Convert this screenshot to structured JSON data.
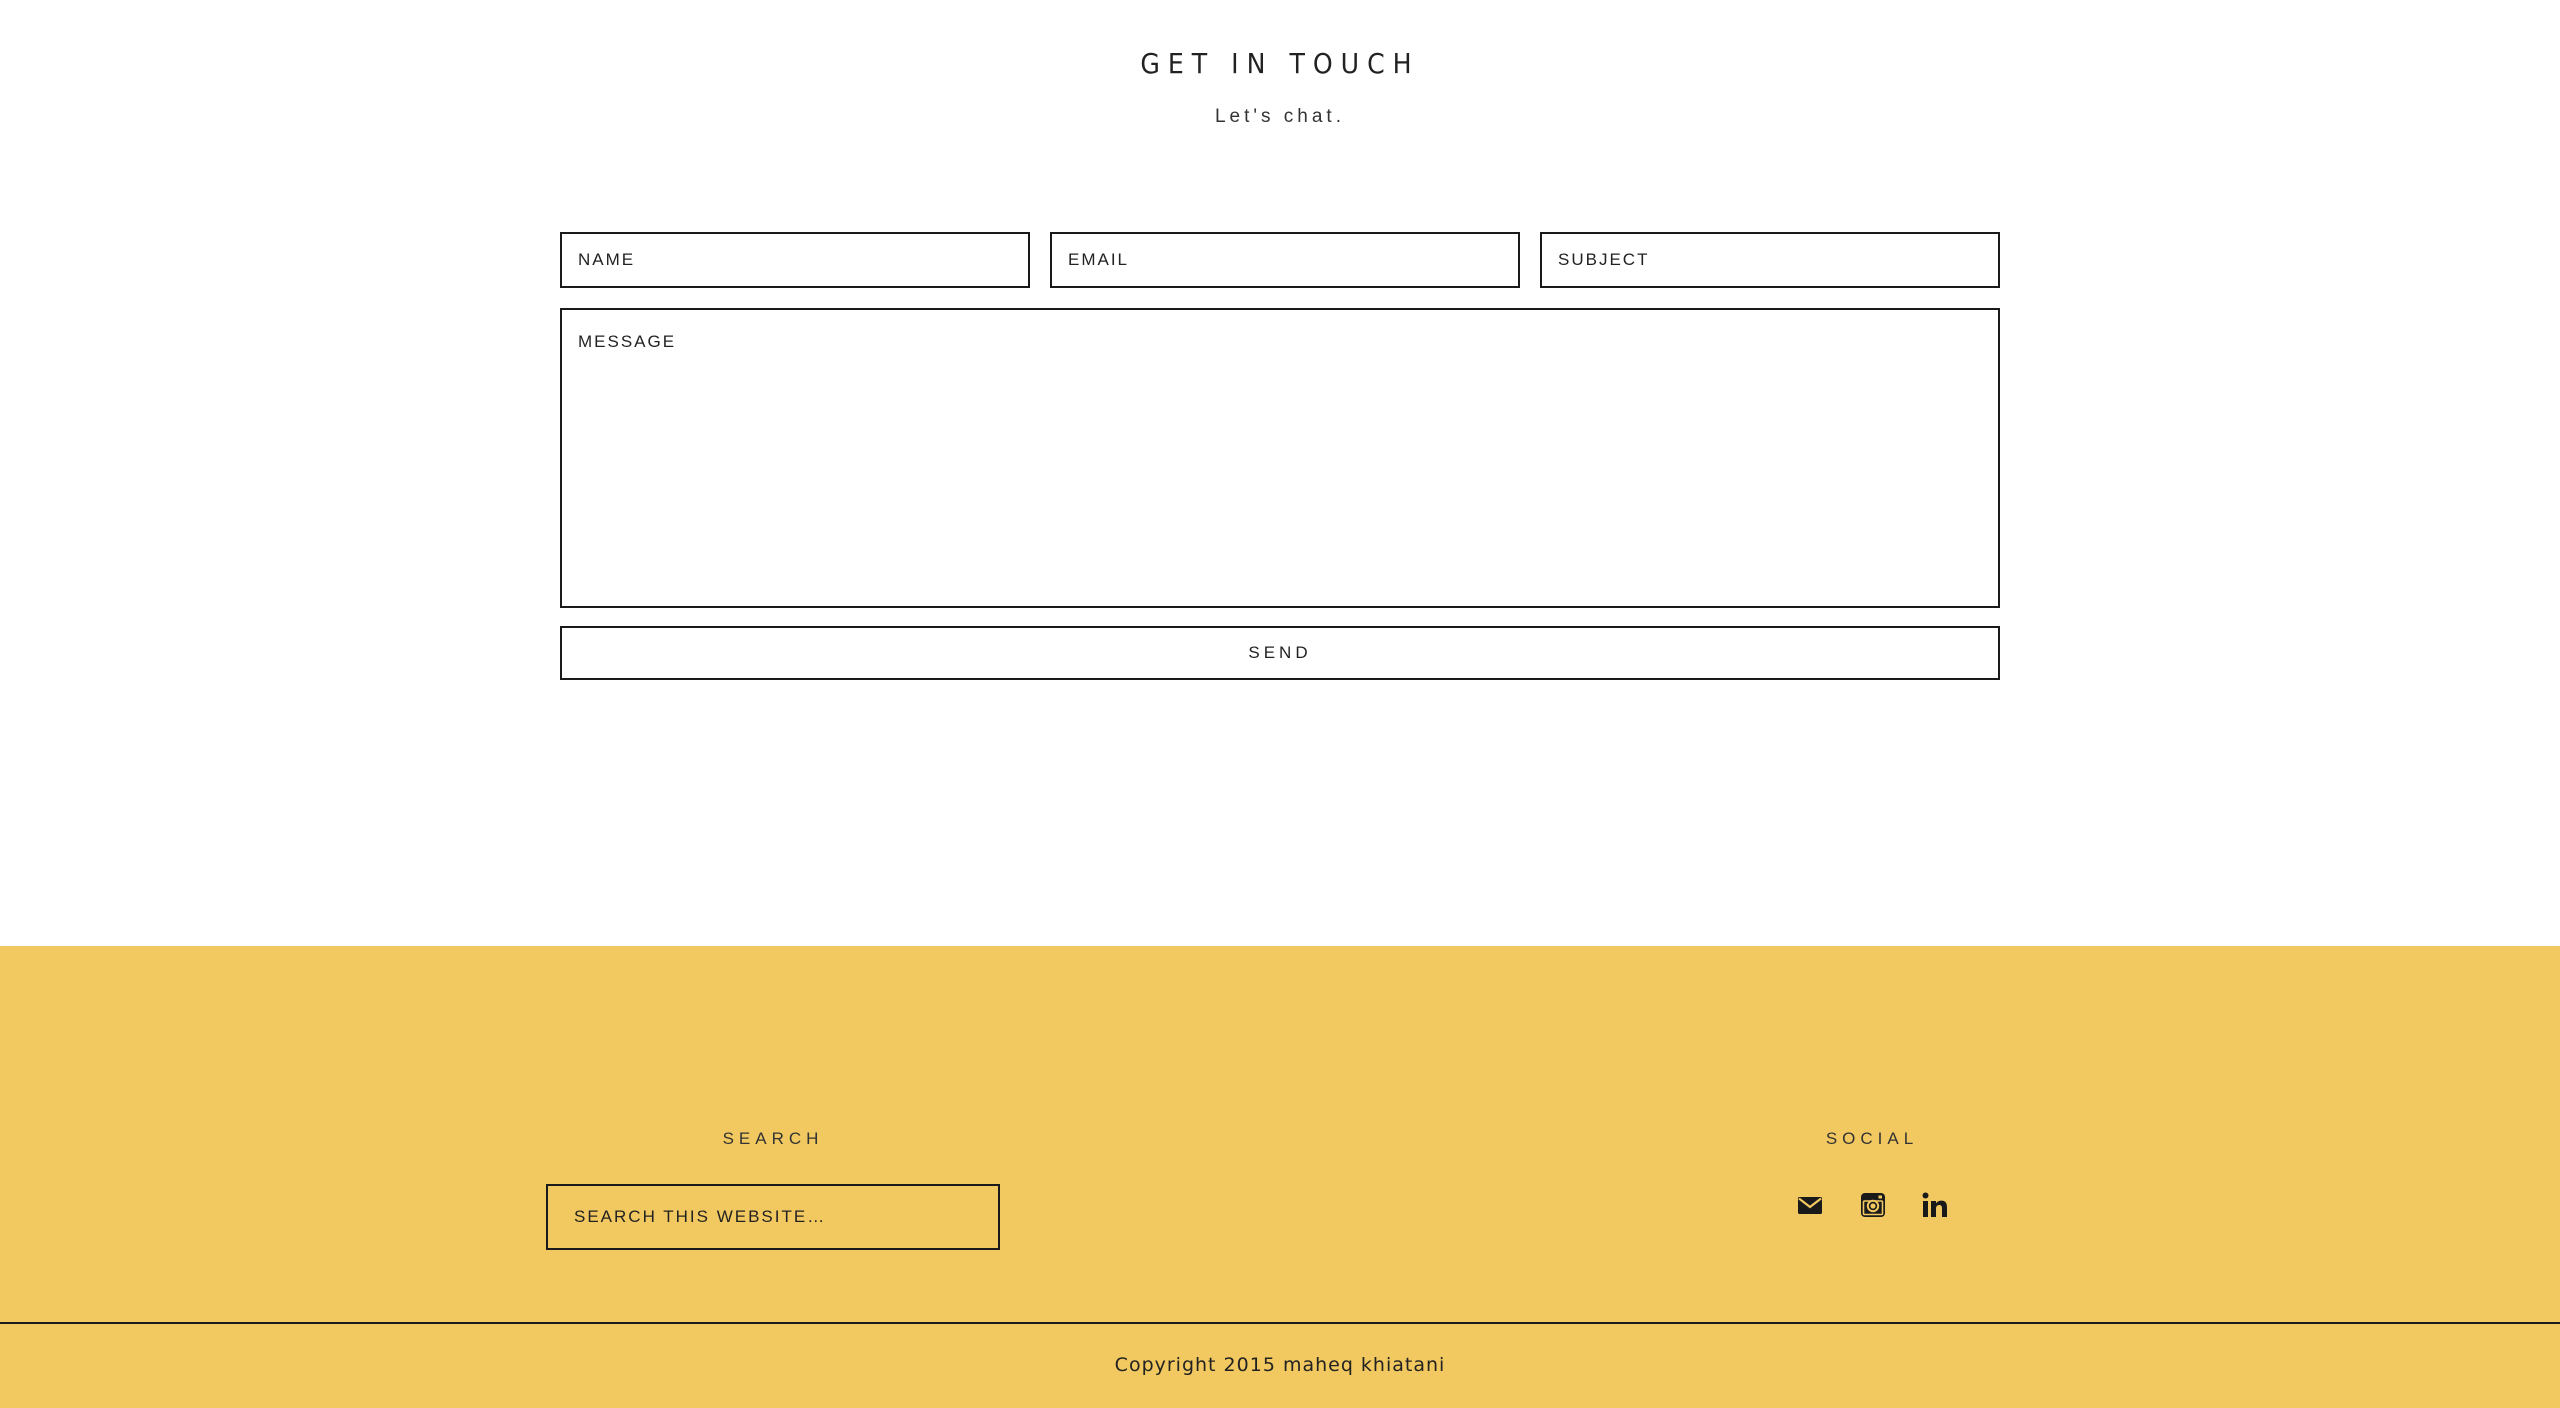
{
  "contact": {
    "title": "GET IN TOUCH",
    "subtitle": "Let's chat.",
    "fields": {
      "name_placeholder": "NAME",
      "email_placeholder": "EMAIL",
      "subject_placeholder": "SUBJECT",
      "message_placeholder": "MESSAGE"
    },
    "send_label": "SEND"
  },
  "footer": {
    "search": {
      "title": "SEARCH",
      "placeholder": "SEARCH THIS WEBSITE…"
    },
    "social": {
      "title": "SOCIAL",
      "icons": [
        "mail-icon",
        "instagram-icon",
        "linkedin-icon"
      ]
    },
    "copyright": "Copyright 2015 maheq khiatani",
    "background_color": "#f2c960"
  }
}
